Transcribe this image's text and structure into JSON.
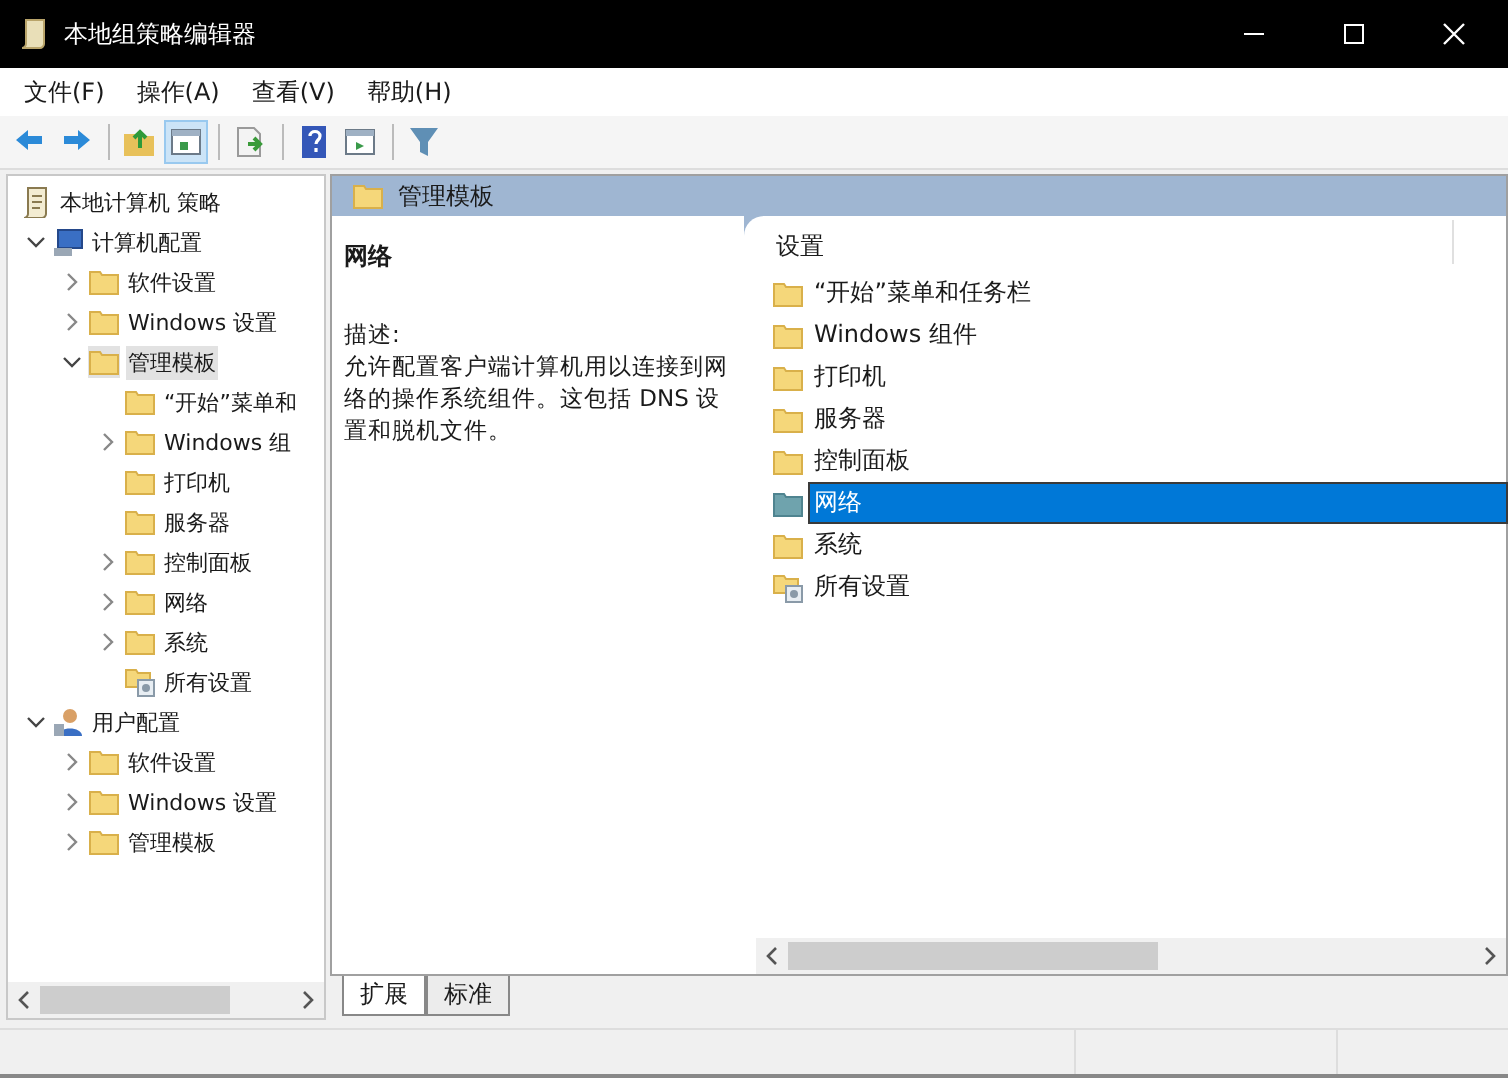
{
  "window": {
    "title": "本地组策略编辑器"
  },
  "menu": [
    "文件(F)",
    "操作(A)",
    "查看(V)",
    "帮助(H)"
  ],
  "toolbar": [
    {
      "kind": "back",
      "pressed": false
    },
    {
      "kind": "forward",
      "pressed": false
    },
    {
      "kind": "separator"
    },
    {
      "kind": "up",
      "pressed": false
    },
    {
      "kind": "tree",
      "pressed": true
    },
    {
      "kind": "separator"
    },
    {
      "kind": "export",
      "pressed": false
    },
    {
      "kind": "separator"
    },
    {
      "kind": "help",
      "pressed": false
    },
    {
      "kind": "view",
      "pressed": false
    },
    {
      "kind": "separator"
    },
    {
      "kind": "filter",
      "pressed": false
    }
  ],
  "tree": [
    {
      "label": "本地计算机 策略",
      "kind": "policy",
      "selected": false,
      "children": [
        {
          "label": "计算机配置",
          "kind": "computer",
          "expanded": true,
          "selected": false,
          "children": [
            {
              "label": "软件设置",
              "kind": "folder",
              "expanded": false,
              "selected": false
            },
            {
              "label": "Windows 设置",
              "kind": "folder",
              "expanded": false,
              "selected": false
            },
            {
              "label": "管理模板",
              "kind": "folder",
              "expanded": true,
              "selected": true,
              "children": [
                {
                  "label": "“开始”菜单和",
                  "kind": "folder",
                  "selected": false
                },
                {
                  "label": "Windows 组",
                  "kind": "folder",
                  "expanded": false,
                  "selected": false
                },
                {
                  "label": "打印机",
                  "kind": "folder",
                  "selected": false
                },
                {
                  "label": "服务器",
                  "kind": "folder",
                  "selected": false
                },
                {
                  "label": "控制面板",
                  "kind": "folder",
                  "expanded": false,
                  "selected": false
                },
                {
                  "label": "网络",
                  "kind": "folder",
                  "expanded": false,
                  "selected": false
                },
                {
                  "label": "系统",
                  "kind": "folder",
                  "expanded": false,
                  "selected": false
                },
                {
                  "label": "所有设置",
                  "kind": "settings",
                  "selected": false
                }
              ]
            }
          ]
        },
        {
          "label": "用户配置",
          "kind": "user",
          "expanded": true,
          "selected": false,
          "children": [
            {
              "label": "软件设置",
              "kind": "folder",
              "expanded": false,
              "selected": false
            },
            {
              "label": "Windows 设置",
              "kind": "folder",
              "expanded": false,
              "selected": false
            },
            {
              "label": "管理模板",
              "kind": "folder",
              "expanded": false,
              "selected": false
            }
          ]
        }
      ]
    }
  ],
  "details": {
    "header": "管理模板",
    "title": "网络",
    "description_label": "描述:",
    "description": "允许配置客户端计算机用以连接到网络的操作系统组件。这包括 DNS 设置和脱机文件。"
  },
  "list": {
    "column": "设置",
    "items": [
      {
        "label": "“开始”菜单和任务栏",
        "kind": "folder",
        "selected": false
      },
      {
        "label": "Windows 组件",
        "kind": "folder",
        "selected": false
      },
      {
        "label": "打印机",
        "kind": "folder",
        "selected": false
      },
      {
        "label": "服务器",
        "kind": "folder",
        "selected": false
      },
      {
        "label": "控制面板",
        "kind": "folder",
        "selected": false
      },
      {
        "label": "网络",
        "kind": "network",
        "selected": true
      },
      {
        "label": "系统",
        "kind": "folder",
        "selected": false
      },
      {
        "label": "所有设置",
        "kind": "settings",
        "selected": false
      }
    ]
  },
  "tabs": [
    {
      "label": "扩展",
      "selected": true
    },
    {
      "label": "标准",
      "selected": false
    }
  ]
}
